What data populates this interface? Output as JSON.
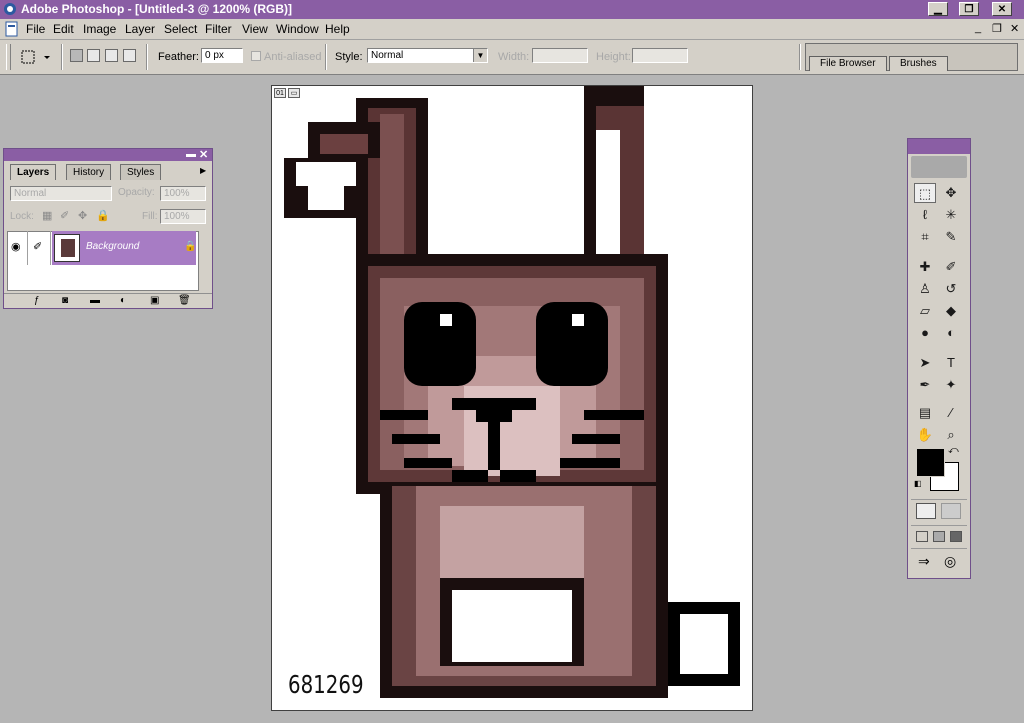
{
  "app": {
    "title": "Adobe Photoshop - [Untitled-3 @ 1200% (RGB)]",
    "window_controls": {
      "minimize": "▁",
      "restore": "❐",
      "close": "✕"
    },
    "mdi_controls": {
      "minimize": "_",
      "restore": "❐",
      "close": "✕"
    }
  },
  "menu": [
    "File",
    "Edit",
    "Image",
    "Layer",
    "Select",
    "Filter",
    "View",
    "Window",
    "Help"
  ],
  "options_bar": {
    "feather_label": "Feather:",
    "feather_value": "0 px",
    "anti_aliased_label": "Anti-aliased",
    "style_label": "Style:",
    "style_value": "Normal",
    "width_label": "Width:",
    "height_label": "Height:"
  },
  "palette_well": {
    "tabs": [
      "File Browser",
      "Brushes"
    ]
  },
  "layers_palette": {
    "tabs": [
      "Layers",
      "History",
      "Styles"
    ],
    "blend_mode": "Normal",
    "opacity_label": "Opacity:",
    "opacity_value": "100%",
    "lock_label": "Lock:",
    "fill_label": "Fill:",
    "fill_value": "100%",
    "layers": [
      {
        "name": "Background",
        "visible": true,
        "locked": true
      }
    ]
  },
  "document": {
    "watermark": "681269",
    "corner_label": "01"
  },
  "toolbox": {
    "tools": [
      {
        "name": "rectangular-marquee",
        "glyph": "⬚"
      },
      {
        "name": "move",
        "glyph": "✥"
      },
      {
        "name": "lasso",
        "glyph": "ℓ"
      },
      {
        "name": "magic-wand",
        "glyph": "✳"
      },
      {
        "name": "crop",
        "glyph": "⌗"
      },
      {
        "name": "slice",
        "glyph": "✎"
      },
      {
        "name": "healing-brush",
        "glyph": "✚"
      },
      {
        "name": "brush",
        "glyph": "✐"
      },
      {
        "name": "clone-stamp",
        "glyph": "♙"
      },
      {
        "name": "history-brush",
        "glyph": "↺"
      },
      {
        "name": "eraser",
        "glyph": "▱"
      },
      {
        "name": "paint-bucket",
        "glyph": "◆"
      },
      {
        "name": "blur",
        "glyph": "●"
      },
      {
        "name": "dodge",
        "glyph": "◐"
      },
      {
        "name": "path-selection",
        "glyph": "➤"
      },
      {
        "name": "type",
        "glyph": "T"
      },
      {
        "name": "pen",
        "glyph": "✒"
      },
      {
        "name": "custom-shape",
        "glyph": "✦"
      },
      {
        "name": "notes",
        "glyph": "▤"
      },
      {
        "name": "eyedropper",
        "glyph": "⁄"
      },
      {
        "name": "hand",
        "glyph": "✋"
      },
      {
        "name": "zoom",
        "glyph": "⌕"
      }
    ],
    "foreground_color": "#000000",
    "background_color": "#ffffff"
  },
  "colors": {
    "title_purple": "#8a5ea4",
    "workspace_gray": "#b5b5b5",
    "chrome": "#d4d0c8",
    "layer_selected": "#a77cc4"
  }
}
